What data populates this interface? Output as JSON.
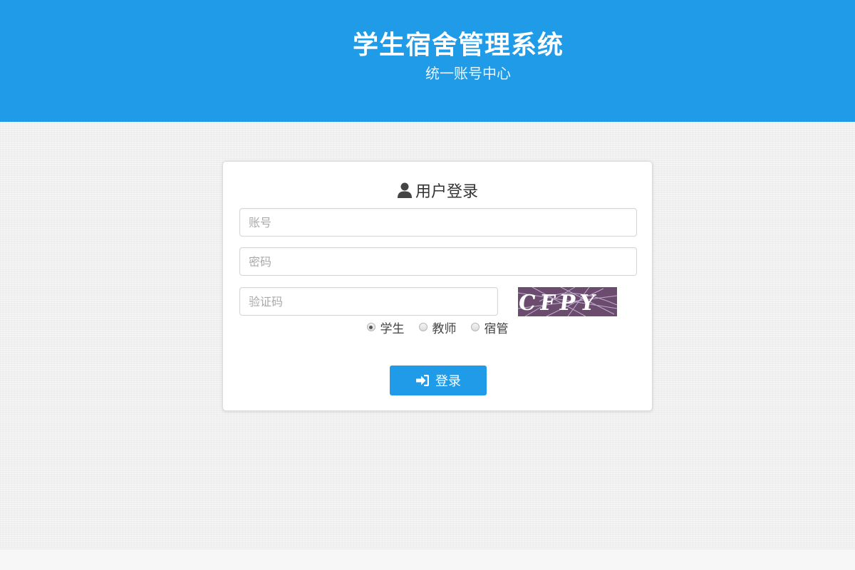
{
  "header": {
    "title": "学生宿舍管理系统",
    "subtitle": "统一账号中心"
  },
  "login": {
    "title": "用户登录",
    "title_icon": "user-icon",
    "account_placeholder": "账号",
    "password_placeholder": "密码",
    "captcha_placeholder": "验证码",
    "captcha_text": "CFPY",
    "roles": [
      {
        "label": "学生",
        "checked": true
      },
      {
        "label": "教师",
        "checked": false
      },
      {
        "label": "宿管",
        "checked": false
      }
    ],
    "submit_label": "登录",
    "submit_icon": "sign-in-icon"
  },
  "colors": {
    "brand": "#1f9be8",
    "captcha_bg": "#6b4c6f"
  }
}
